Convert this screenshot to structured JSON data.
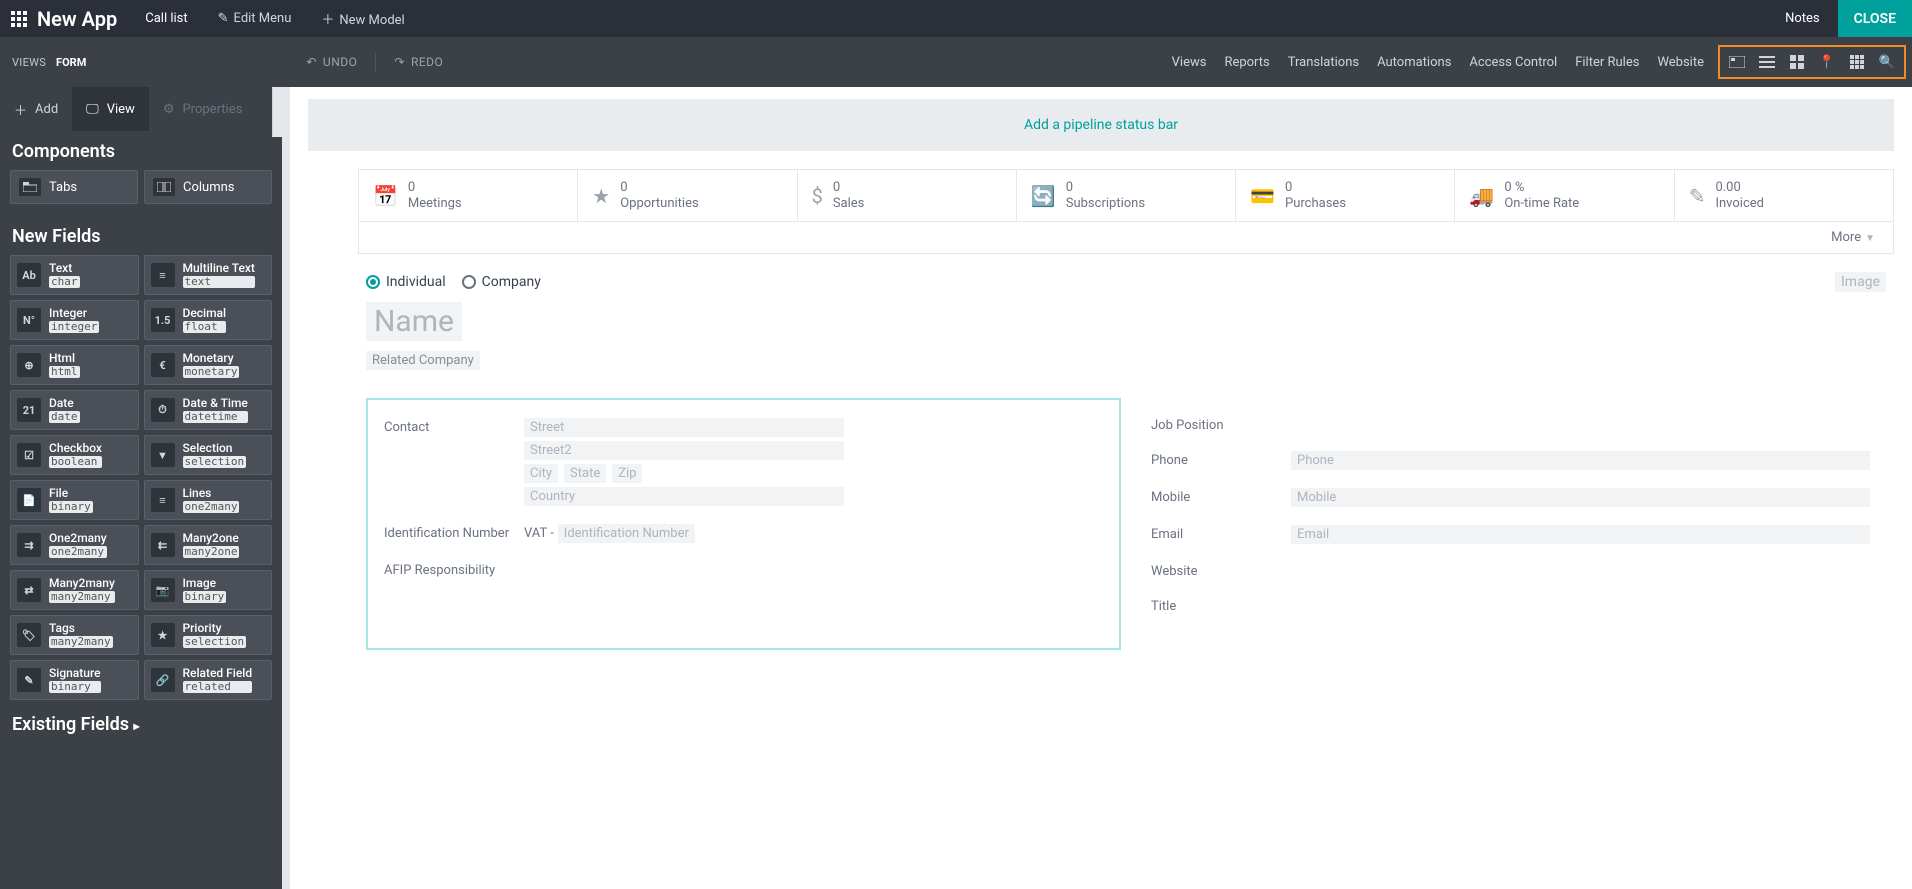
{
  "header": {
    "app_title": "New App",
    "call_list": "Call list",
    "edit_menu": "Edit Menu",
    "new_model": "New Model",
    "notes": "Notes",
    "close": "CLOSE"
  },
  "subheader": {
    "views_label": "VIEWS",
    "form_label": "FORM",
    "undo": "UNDO",
    "redo": "REDO",
    "nav": [
      "Views",
      "Reports",
      "Translations",
      "Automations",
      "Access Control",
      "Filter Rules",
      "Website"
    ]
  },
  "side_tabs": {
    "add": "Add",
    "view": "View",
    "properties": "Properties"
  },
  "components": {
    "title": "Components",
    "tabs": "Tabs",
    "columns": "Columns"
  },
  "new_fields": {
    "title": "New Fields",
    "items": [
      {
        "name": "Text",
        "type": "char",
        "icon": "Ab"
      },
      {
        "name": "Multiline Text",
        "type": "text",
        "icon": "≡"
      },
      {
        "name": "Integer",
        "type": "integer",
        "icon": "N°"
      },
      {
        "name": "Decimal",
        "type": "float",
        "icon": "1.5"
      },
      {
        "name": "Html",
        "type": "html",
        "icon": "⊕"
      },
      {
        "name": "Monetary",
        "type": "monetary",
        "icon": "€"
      },
      {
        "name": "Date",
        "type": "date",
        "icon": "21"
      },
      {
        "name": "Date & Time",
        "type": "datetime",
        "icon": "⏱"
      },
      {
        "name": "Checkbox",
        "type": "boolean",
        "icon": "☑"
      },
      {
        "name": "Selection",
        "type": "selection",
        "icon": "▼"
      },
      {
        "name": "File",
        "type": "binary",
        "icon": "📄"
      },
      {
        "name": "Lines",
        "type": "one2many",
        "icon": "≡"
      },
      {
        "name": "One2many",
        "type": "one2many",
        "icon": "⇉"
      },
      {
        "name": "Many2one",
        "type": "many2one",
        "icon": "⇇"
      },
      {
        "name": "Many2many",
        "type": "many2many",
        "icon": "⇄"
      },
      {
        "name": "Image",
        "type": "binary",
        "icon": "📷"
      },
      {
        "name": "Tags",
        "type": "many2many",
        "icon": "🏷"
      },
      {
        "name": "Priority",
        "type": "selection",
        "icon": "★"
      },
      {
        "name": "Signature",
        "type": "binary",
        "icon": "✎"
      },
      {
        "name": "Related Field",
        "type": "related",
        "icon": "🔗"
      }
    ]
  },
  "existing_fields_title": "Existing Fields",
  "canvas": {
    "pipeline_hint": "Add a pipeline status bar",
    "stats": [
      {
        "value": "0",
        "label": "Meetings"
      },
      {
        "value": "0",
        "label": "Opportunities"
      },
      {
        "value": "0",
        "label": "Sales"
      },
      {
        "value": "0",
        "label": "Subscriptions"
      },
      {
        "value": "0",
        "label": "Purchases"
      },
      {
        "value": "0 %",
        "label": "On-time Rate"
      },
      {
        "value": "0.00",
        "label": "Invoiced"
      }
    ],
    "more": "More",
    "radio": {
      "individual": "Individual",
      "company": "Company"
    },
    "image_ph": "Image",
    "name_ph": "Name",
    "company_ph": "Related Company",
    "left": {
      "contact": "Contact",
      "street": "Street",
      "street2": "Street2",
      "city": "City",
      "state": "State",
      "zip": "Zip",
      "country": "Country",
      "id_number": "Identification Number",
      "vat": "VAT -",
      "id_number_ph": "Identification Number",
      "afip": "AFIP Responsibility"
    },
    "right": {
      "job": "Job Position",
      "phone": "Phone",
      "phone_ph": "Phone",
      "mobile": "Mobile",
      "mobile_ph": "Mobile",
      "email": "Email",
      "email_ph": "Email",
      "website": "Website",
      "title": "Title"
    }
  }
}
